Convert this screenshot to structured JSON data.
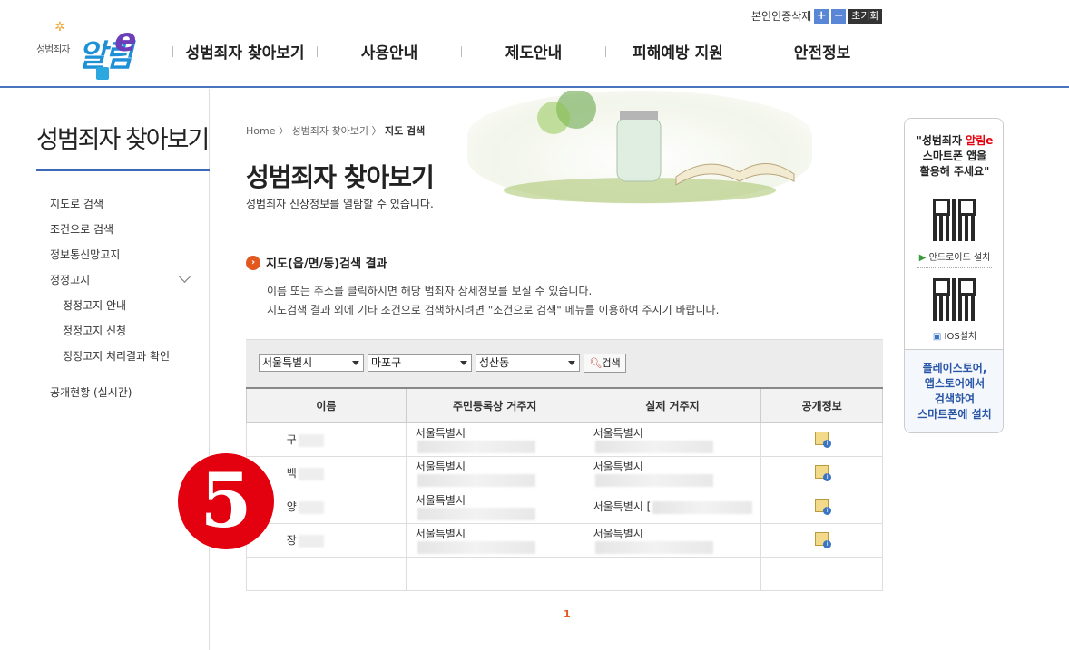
{
  "header": {
    "logo_brand": "성범죄자",
    "logo_text": "알림",
    "logo_e": "e",
    "cert_delete": "본인인증삭제",
    "zoom_in": "+",
    "zoom_out": "−",
    "reset": "초기화",
    "nav": [
      "성범죄자 찾아보기",
      "사용안내",
      "제도안내",
      "피해예방 지원",
      "안전정보"
    ]
  },
  "sidebar": {
    "title": "성범죄자 찾아보기",
    "items": [
      "지도로 검색",
      "조건으로 검색",
      "정보통신망고지",
      "정정고지"
    ],
    "sub_items": [
      "정정고지 안내",
      "정정고지 신청",
      "정정고지 처리결과 확인"
    ],
    "extra": "공개현황 (실시간)"
  },
  "breadcrumb": [
    "Home",
    "성범죄자 찾아보기",
    "지도 검색"
  ],
  "page": {
    "title": "성범죄자 찾아보기",
    "subtitle": "성범죄자 신상정보를 열람할 수 있습니다."
  },
  "section": {
    "title": "지도(읍/면/동)검색 결과",
    "desc1": "이름 또는 주소를 클릭하시면 해당 범죄자 상세정보를 보실 수 있습니다.",
    "desc2": "지도검색 결과 외에 기타 조건으로 검색하시려면 \"조건으로 검색\" 메뉴를 이용하여 주시기 바랍니다."
  },
  "search": {
    "city": "서울특별시",
    "district": "마포구",
    "dong": "성산동",
    "button": "검색"
  },
  "table": {
    "headers": [
      "이름",
      "주민등록상 거주지",
      "실제 거주지",
      "공개정보"
    ],
    "rows": [
      {
        "name": "구",
        "reg": "서울특별시",
        "actual": "서울특별시"
      },
      {
        "name": "백",
        "reg": "서울특별시",
        "actual": "서울특별시"
      },
      {
        "name": "양",
        "reg": "서울특별시",
        "actual": "서울특별시 ["
      },
      {
        "name": "장",
        "reg": "서울특별시",
        "actual": "서울특별시"
      }
    ]
  },
  "pagination": {
    "current": "1"
  },
  "annotation": {
    "number": "5"
  },
  "app_banner": {
    "line1a": "\"성범죄자 ",
    "line1b": "알림e",
    "line2": "스마트폰 앱을",
    "line3": "활용해 주세요\"",
    "android": "안드로이드 설치",
    "ios": "IOS설치",
    "store1": "플레이스토어,",
    "store2": "앱스토어에서",
    "store3": "검색하여",
    "store4": "스마트폰에 설치"
  }
}
